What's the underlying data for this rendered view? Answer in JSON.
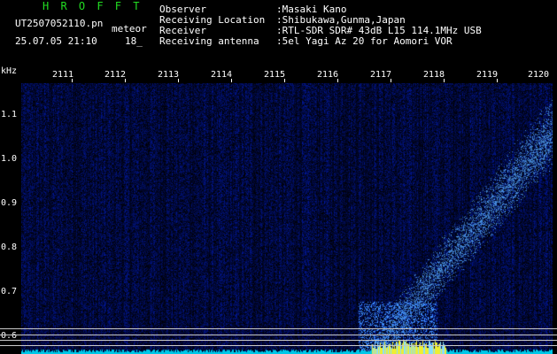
{
  "header": {
    "brand": "H R O F F T",
    "filename": "UT2507052110.pn",
    "mode": "meteor",
    "timestamp": "25.07.05 21:10",
    "event_count": "18_"
  },
  "info": [
    {
      "label": "Observer",
      "value": ":Masaki Kano"
    },
    {
      "label": "Receiving Location",
      "value": ":Shibukawa,Gunma,Japan"
    },
    {
      "label": "Receiver",
      "value": ":RTL-SDR SDR# 43dB L15 114.1MHz USB"
    },
    {
      "label": "Receiving antenna",
      "value": ":5el Yagi Az 20 for Aomori VOR"
    }
  ],
  "axis": {
    "unit": "kHz",
    "ticks": [
      "1.1",
      "1.0",
      "0.9",
      "0.8",
      "0.7",
      "0.6"
    ]
  },
  "time_markers": [
    "2111",
    "2112",
    "2113",
    "2114",
    "2115",
    "2116",
    "2117",
    "2118",
    "2119",
    "2120"
  ],
  "colors": {
    "brand": "#22dd22",
    "text": "#ffffff",
    "signal_hot": "#eeee33",
    "signal_bright": "#88ddff",
    "noise": "#001a8a",
    "baseline": "#00c8e8"
  }
}
